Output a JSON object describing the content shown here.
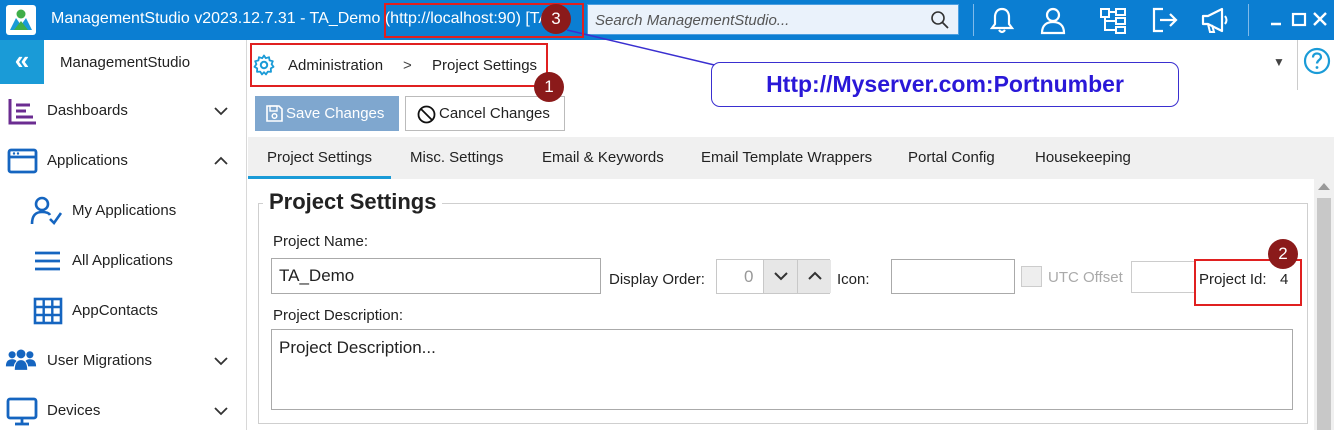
{
  "window": {
    "title": "ManagementStudio v2023.12.7.31 - TA_Demo (http://localhost:90) [TA",
    "search_placeholder": "Search ManagementStudio...",
    "accent": "#0b7ed2"
  },
  "titlebar_icons": [
    "bell-icon",
    "user-icon",
    "hierarchy-icon",
    "sign-out-icon",
    "megaphone-icon",
    "minimize-icon",
    "maximize-icon",
    "close-icon"
  ],
  "sidebar": {
    "collapse_glyph": "«",
    "app_name": "ManagementStudio",
    "items": [
      {
        "label": "Dashboards",
        "icon": "dashboard-icon",
        "chevron": "down"
      },
      {
        "label": "Applications",
        "icon": "applications-icon",
        "chevron": "up"
      },
      {
        "label": "My Applications",
        "icon": "user-check-icon"
      },
      {
        "label": "All Applications",
        "icon": "list-icon"
      },
      {
        "label": "AppContacts",
        "icon": "grid-icon"
      },
      {
        "label": "User Migrations",
        "icon": "users-icon",
        "chevron": "down"
      },
      {
        "label": "Devices",
        "icon": "monitor-icon",
        "chevron": "down"
      }
    ]
  },
  "breadcrumb": {
    "root": "Administration",
    "separator": ">",
    "current": "Project Settings"
  },
  "toolbar": {
    "save_label": "Save Changes",
    "cancel_label": "Cancel Changes"
  },
  "tabs": [
    {
      "label": "Project Settings",
      "active": true
    },
    {
      "label": "Misc. Settings"
    },
    {
      "label": "Email & Keywords"
    },
    {
      "label": "Email Template Wrappers"
    },
    {
      "label": "Portal Config"
    },
    {
      "label": "Housekeeping"
    }
  ],
  "form": {
    "group_title": "Project Settings",
    "project_name_label": "Project Name:",
    "project_name_value": "TA_Demo",
    "display_order_label": "Display Order:",
    "display_order_value": "0",
    "icon_label": "Icon:",
    "icon_value": "",
    "utc_offset_label": "UTC Offset",
    "utc_offset_value": "",
    "project_id_label": "Project Id:",
    "project_id_value": "4",
    "description_label": "Project Description:",
    "description_value": "Project Description..."
  },
  "annotations": {
    "badges": [
      "1",
      "2",
      "3"
    ],
    "callout": "Http://Myserver.com:Portnumber",
    "color_box": "#e02020",
    "color_badge": "#8b1a1a",
    "color_callout": "#2a18d8"
  }
}
